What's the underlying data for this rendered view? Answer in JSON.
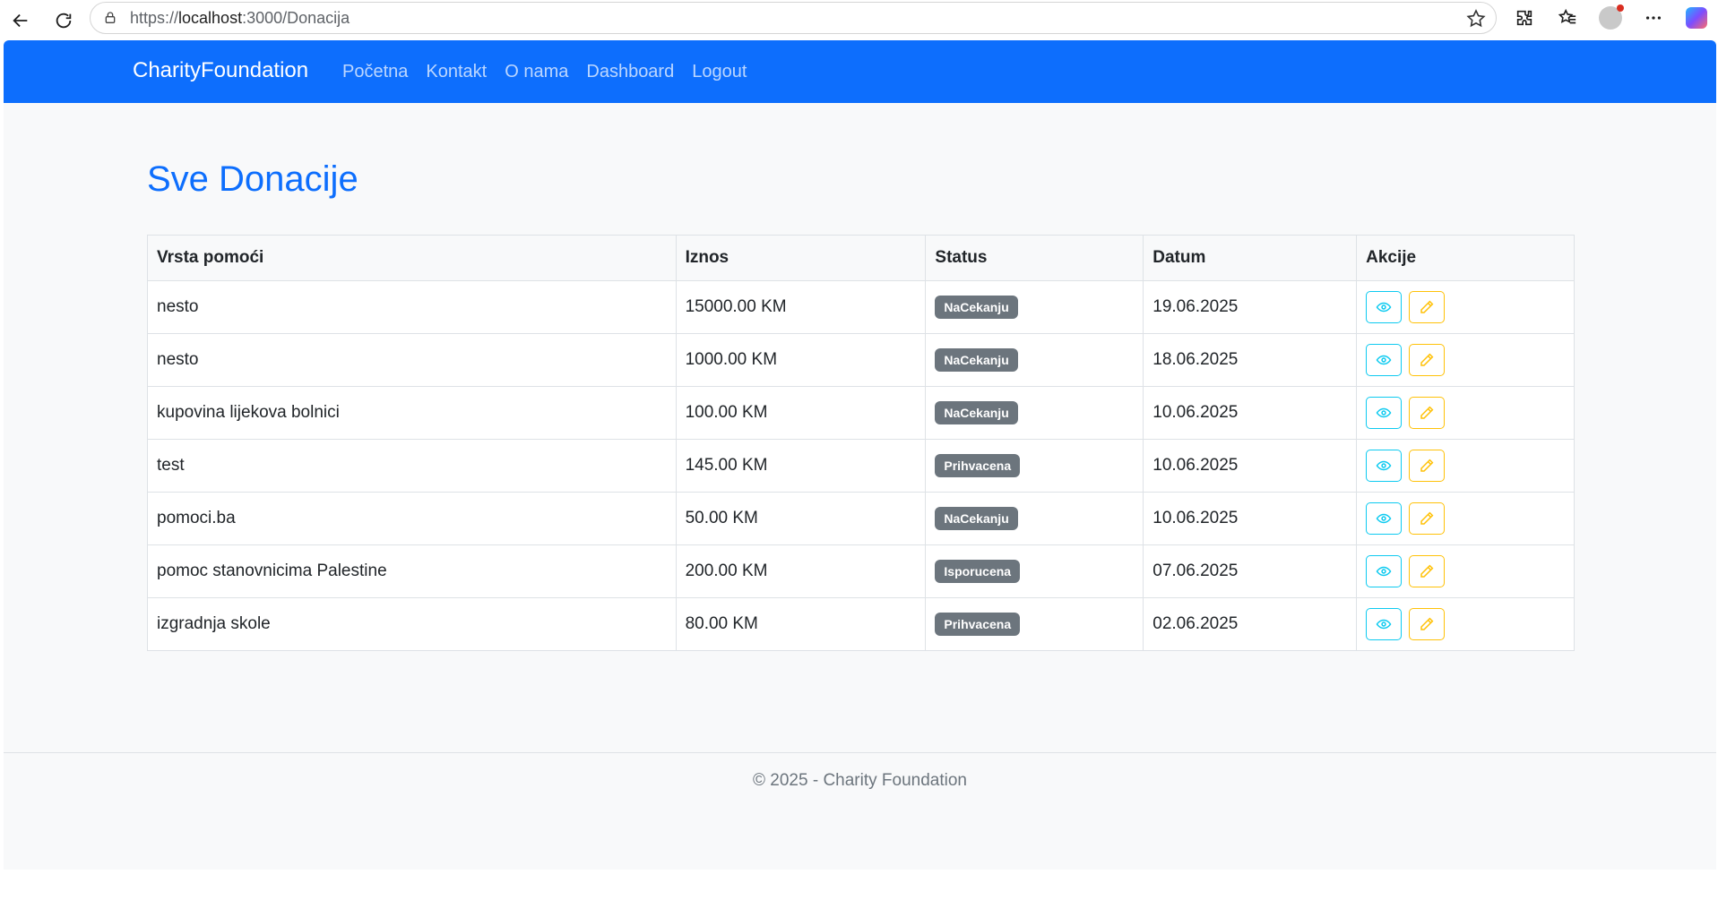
{
  "browser": {
    "url_prefix": "https://",
    "url_host": "localhost",
    "url_rest": ":3000/Donacija"
  },
  "navbar": {
    "brand": "CharityFoundation",
    "links": [
      "Početna",
      "Kontakt",
      "O nama",
      "Dashboard",
      "Logout"
    ]
  },
  "page": {
    "title": "Sve Donacije"
  },
  "table": {
    "headers": [
      "Vrsta pomoći",
      "Iznos",
      "Status",
      "Datum",
      "Akcije"
    ],
    "rows": [
      {
        "vrsta": "nesto",
        "iznos": "15000.00 KM",
        "status": "NaCekanju",
        "datum": "19.06.2025"
      },
      {
        "vrsta": "nesto",
        "iznos": "1000.00 KM",
        "status": "NaCekanju",
        "datum": "18.06.2025"
      },
      {
        "vrsta": "kupovina lijekova bolnici",
        "iznos": "100.00 KM",
        "status": "NaCekanju",
        "datum": "10.06.2025"
      },
      {
        "vrsta": "test",
        "iznos": "145.00 KM",
        "status": "Prihvacena",
        "datum": "10.06.2025"
      },
      {
        "vrsta": "pomoci.ba",
        "iznos": "50.00 KM",
        "status": "NaCekanju",
        "datum": "10.06.2025"
      },
      {
        "vrsta": "pomoc stanovnicima Palestine",
        "iznos": "200.00 KM",
        "status": "Isporucena",
        "datum": "07.06.2025"
      },
      {
        "vrsta": "izgradnja skole",
        "iznos": "80.00 KM",
        "status": "Prihvacena",
        "datum": "02.06.2025"
      }
    ],
    "actions": {
      "view_icon": "eye-icon",
      "edit_icon": "pencil-icon"
    }
  },
  "footer": {
    "text": "© 2025 - Charity Foundation"
  },
  "colors": {
    "primary": "#0d6efd",
    "badge": "#6c757d",
    "view_button": "#0dcaf0",
    "edit_button": "#ffc107"
  }
}
